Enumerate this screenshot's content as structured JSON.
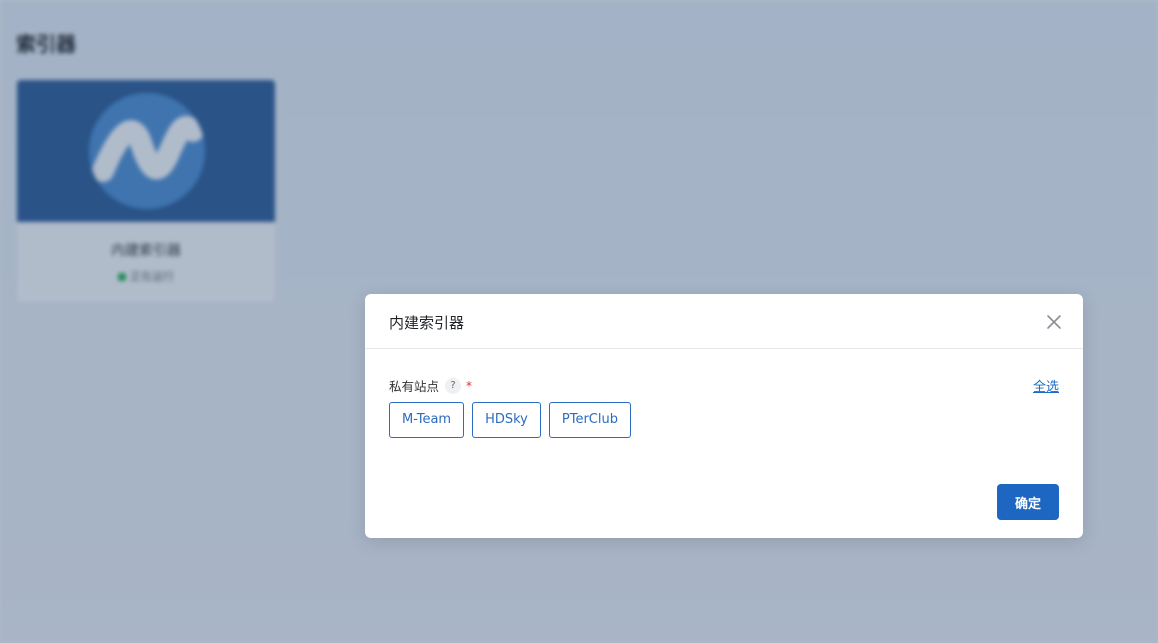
{
  "background": {
    "page_title": "索引器",
    "card": {
      "name": "内建索引器",
      "status": "正在运行"
    }
  },
  "dialog": {
    "title": "内建索引器",
    "field": {
      "label": "私有站点",
      "help_icon": "?",
      "required_mark": "*"
    },
    "select_all": "全选",
    "sites": [
      "M-Team",
      "HDSky",
      "PTerClub"
    ],
    "confirm_label": "确定"
  },
  "icons": {
    "close": "close-icon",
    "help": "question-circle-icon",
    "logo": "indexer-logo"
  },
  "colors": {
    "accent": "#1d66c2",
    "required": "#e03131",
    "status_ok": "#2bb54a"
  }
}
